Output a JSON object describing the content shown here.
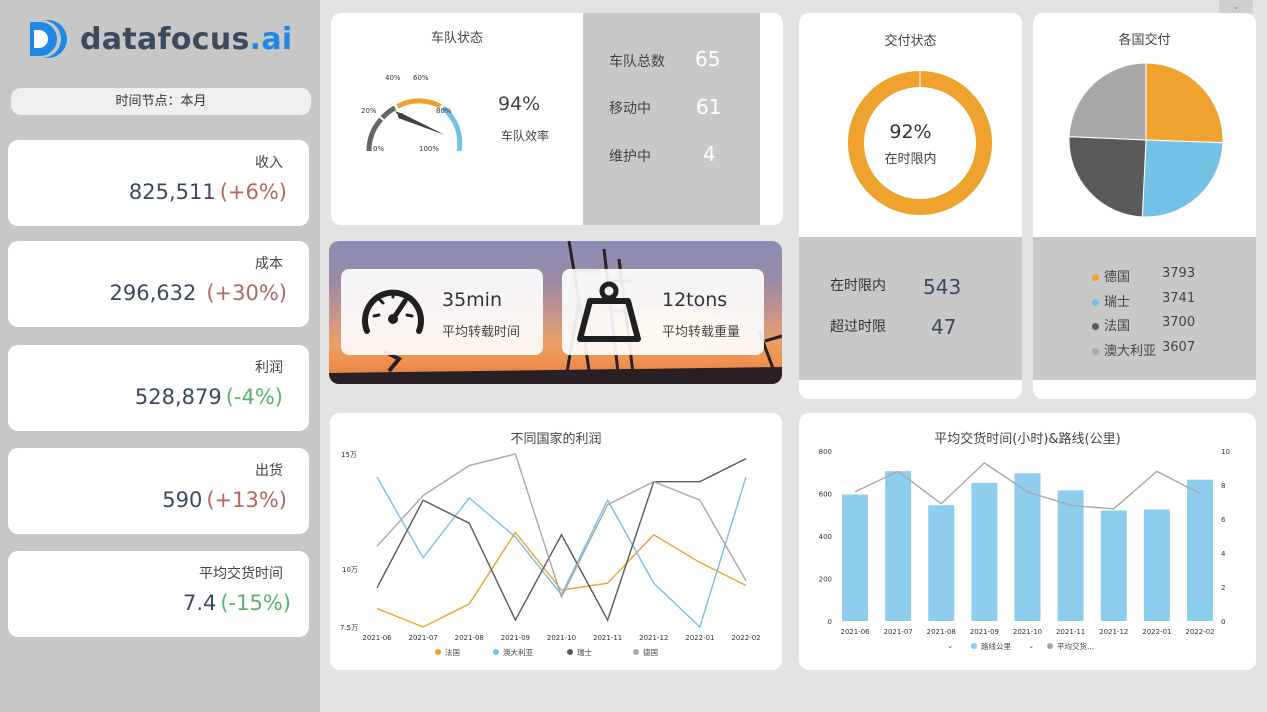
{
  "brand": {
    "name_main": "datafocus",
    "name_ext": ".ai"
  },
  "time_node": "时间节点：本月",
  "kpis": [
    {
      "label": "收入",
      "value": "825,511",
      "change": "(+6%)",
      "trend": "up"
    },
    {
      "label": "成本",
      "value": "296,632",
      "change": "(+30%)",
      "trend": "up"
    },
    {
      "label": "利润",
      "value": "528,879",
      "change": "(-4%)",
      "trend": "down"
    },
    {
      "label": "出货",
      "value": "590",
      "change": "(+13%)",
      "trend": "up"
    },
    {
      "label": "平均交货时间",
      "value": "7.4",
      "change": "(-15%)",
      "trend": "down"
    }
  ],
  "fleet": {
    "title": "车队状态",
    "efficiency_value": "94%",
    "efficiency_label": "车队效率",
    "gauge_ticks": [
      "0%",
      "20%",
      "40%",
      "60%",
      "80%",
      "100%"
    ],
    "gauge_value": 0.94,
    "stats": [
      {
        "label": "车队总数",
        "value": "65"
      },
      {
        "label": "移动中",
        "value": "61"
      },
      {
        "label": "维护中",
        "value": "4"
      }
    ]
  },
  "banner": {
    "turnaround_value": "35min",
    "turnaround_label": "平均转载时间",
    "weight_value": "12tons",
    "weight_label": "平均转载重量"
  },
  "delivery": {
    "title": "交付状态",
    "pct": "92%",
    "pct_label": "在时限内",
    "on_time_label": "在时限内",
    "on_time_value": "543",
    "overdue_label": "超过时限",
    "overdue_value": "47"
  },
  "colors": {
    "orange": "#f0a22e",
    "blue": "#74c1e8",
    "dark": "#5a5a5a",
    "grey": "#a8a8a8",
    "bar": "#8ecdee",
    "up": "#b5665f",
    "down": "#58b46b"
  },
  "icons": [
    "speedometer-icon",
    "weight-icon",
    "dropdown-icon",
    "logo-icon"
  ],
  "countries": {
    "title": "各国交付",
    "items": [
      {
        "name": "德国",
        "value": 3793,
        "value_text": "3793",
        "color": "#f0a22e"
      },
      {
        "name": "瑞士",
        "value": 3741,
        "value_text": "3741",
        "color": "#74c1e8"
      },
      {
        "name": "法国",
        "value": 3700,
        "value_text": "3700",
        "color": "#5a5a5a"
      },
      {
        "name": "澳大利亚",
        "value": 3607,
        "value_text": "3607",
        "color": "#a8a8a8"
      }
    ]
  },
  "chart_data": [
    {
      "type": "line",
      "title": "不同国家的利润",
      "x": [
        "2021-06",
        "2021-07",
        "2021-08",
        "2021-09",
        "2021-10",
        "2021-11",
        "2021-12",
        "2022-01",
        "2022-02"
      ],
      "y_ticks": [
        "15万",
        "10万",
        "7.5万"
      ],
      "series": [
        {
          "name": "法国",
          "color": "#f0a22e",
          "values": [
            8.3,
            7.5,
            8.5,
            11.6,
            9.1,
            9.4,
            11.5,
            10.3,
            9.3
          ]
        },
        {
          "name": "澳大利亚",
          "color": "#74c1e8",
          "values": [
            14.0,
            10.5,
            13.1,
            11.4,
            8.9,
            13.0,
            9.4,
            7.5,
            14.0
          ]
        },
        {
          "name": "瑞士",
          "color": "#5a5a5a",
          "values": [
            9.2,
            13.0,
            12.0,
            7.8,
            11.5,
            7.8,
            13.8,
            13.8,
            14.8
          ]
        },
        {
          "name": "德国",
          "color": "#a8a8a8",
          "values": [
            11.0,
            13.2,
            14.5,
            15.0,
            8.8,
            12.8,
            13.8,
            13.0,
            9.5
          ]
        }
      ]
    },
    {
      "type": "bar",
      "title": "平均交货时间(小时)&路线(公里)",
      "categories": [
        "2021-06",
        "2021-07",
        "2021-08",
        "2021-09",
        "2021-10",
        "2021-11",
        "2021-12",
        "2022-01",
        "2022-02"
      ],
      "ylim": [
        0,
        800
      ],
      "y2lim": [
        0,
        10
      ],
      "y_ticks": [
        "0",
        "200",
        "400",
        "600",
        "800"
      ],
      "y2_ticks": [
        "0",
        "2",
        "4",
        "6",
        "8",
        "10"
      ],
      "series": [
        {
          "name": "路线公里",
          "type": "bar",
          "color": "#8ecdee",
          "values": [
            595,
            705,
            545,
            650,
            695,
            615,
            520,
            525,
            665
          ]
        },
        {
          "name": "平均交货...",
          "type": "line",
          "color": "#a8a8a8",
          "values": [
            7.6,
            8.8,
            6.9,
            9.3,
            7.6,
            6.8,
            6.6,
            8.8,
            7.5
          ]
        }
      ]
    }
  ]
}
